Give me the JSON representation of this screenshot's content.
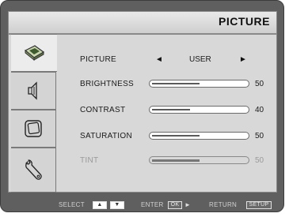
{
  "header": {
    "title": "PICTURE"
  },
  "sidebar": {
    "tabs": [
      {
        "icon": "picture-icon",
        "active": true
      },
      {
        "icon": "speaker-icon",
        "active": false
      },
      {
        "icon": "screen-icon",
        "active": false
      },
      {
        "icon": "wrench-icon",
        "active": false
      }
    ]
  },
  "menu": {
    "picture": {
      "label": "PICTURE",
      "value": "USER",
      "left_arrow": "◄",
      "right_arrow": "►"
    },
    "brightness": {
      "label": "BRIGHTNESS",
      "value": "50",
      "level": 0.5
    },
    "contrast": {
      "label": "CONTRAST",
      "value": "40",
      "level": 0.4
    },
    "saturation": {
      "label": "SATURATION",
      "value": "50",
      "level": 0.5
    },
    "tint": {
      "label": "TINT",
      "value": "50",
      "level": 0.5,
      "disabled": true
    }
  },
  "footer": {
    "select_label": "SELECT",
    "up_key": "▲",
    "down_key": "▼",
    "enter_label": "ENTER",
    "ok_key": "OK",
    "enter_arrow": "►",
    "return_label": "RETURN",
    "setup_key": "SETUP"
  },
  "colors": {
    "frame": "#5f5f5f",
    "panel": "#d8d8d8",
    "header": "#e3e3e3",
    "fill": "#5a5a5a"
  }
}
